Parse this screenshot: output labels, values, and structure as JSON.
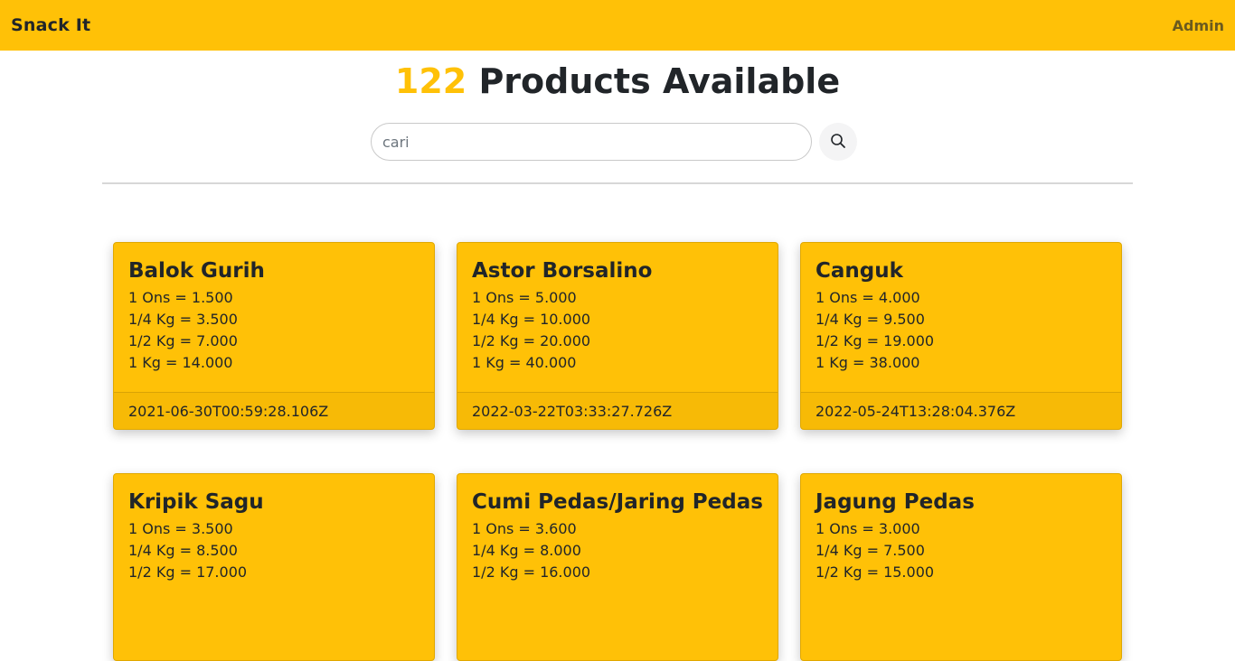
{
  "navbar": {
    "brand": "Snack It",
    "admin_label": "Admin",
    "bg_color": "#ffc107"
  },
  "header": {
    "count": "122",
    "title_rest": " Products Available"
  },
  "search": {
    "placeholder": "cari",
    "button_icon": "search-icon"
  },
  "products": [
    {
      "name": "Balok Gurih",
      "prices": [
        "1 Ons = 1.500",
        "1/4 Kg = 3.500",
        "1/2 Kg = 7.000",
        "1 Kg = 14.000"
      ],
      "timestamp": "2021-06-30T00:59:28.106Z"
    },
    {
      "name": "Astor Borsalino",
      "prices": [
        "1 Ons = 5.000",
        "1/4 Kg = 10.000",
        "1/2 Kg = 20.000",
        "1 Kg = 40.000"
      ],
      "timestamp": "2022-03-22T03:33:27.726Z"
    },
    {
      "name": "Canguk",
      "prices": [
        "1 Ons = 4.000",
        "1/4 Kg = 9.500",
        "1/2 Kg = 19.000",
        "1 Kg = 38.000"
      ],
      "timestamp": "2022-05-24T13:28:04.376Z"
    },
    {
      "name": "Kripik Sagu",
      "prices": [
        "1 Ons = 3.500",
        "1/4 Kg = 8.500",
        "1/2 Kg = 17.000"
      ],
      "timestamp": ""
    },
    {
      "name": "Cumi Pedas/Jaring Pedas",
      "prices": [
        "1 Ons = 3.600",
        "1/4 Kg = 8.000",
        "1/2 Kg = 16.000"
      ],
      "timestamp": ""
    },
    {
      "name": "Jagung Pedas",
      "prices": [
        "1 Ons = 3.000",
        "1/4 Kg = 7.500",
        "1/2 Kg = 15.000"
      ],
      "timestamp": ""
    }
  ]
}
